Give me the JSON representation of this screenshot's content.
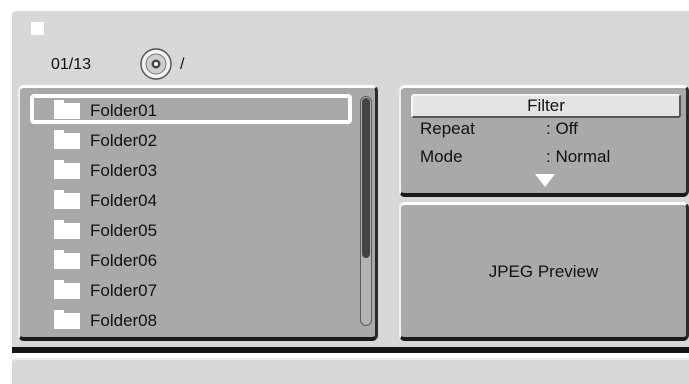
{
  "header": {
    "counter": "01/13",
    "path": "/",
    "disc_icon": "disc-icon",
    "status_icon": "white-square-icon"
  },
  "file_list": {
    "selected_index": 0,
    "items": [
      {
        "label": "Folder01",
        "icon": "folder-icon"
      },
      {
        "label": "Folder02",
        "icon": "folder-icon"
      },
      {
        "label": "Folder03",
        "icon": "folder-icon"
      },
      {
        "label": "Folder04",
        "icon": "folder-icon"
      },
      {
        "label": "Folder05",
        "icon": "folder-icon"
      },
      {
        "label": "Folder06",
        "icon": "folder-icon"
      },
      {
        "label": "Folder07",
        "icon": "folder-icon"
      },
      {
        "label": "Folder08",
        "icon": "folder-icon"
      }
    ]
  },
  "info": {
    "filter_label": "Filter",
    "repeat_label": "Repeat",
    "repeat_value": ": Off",
    "mode_label": "Mode",
    "mode_value": ": Normal",
    "more_icon": "triangle-down-icon"
  },
  "preview": {
    "label": "JPEG Preview"
  },
  "colors": {
    "panel_bg": "#d8d8d8",
    "subpanel_bg": "#a9a9a9",
    "highlight": "#ffffff",
    "text": "#111111"
  }
}
